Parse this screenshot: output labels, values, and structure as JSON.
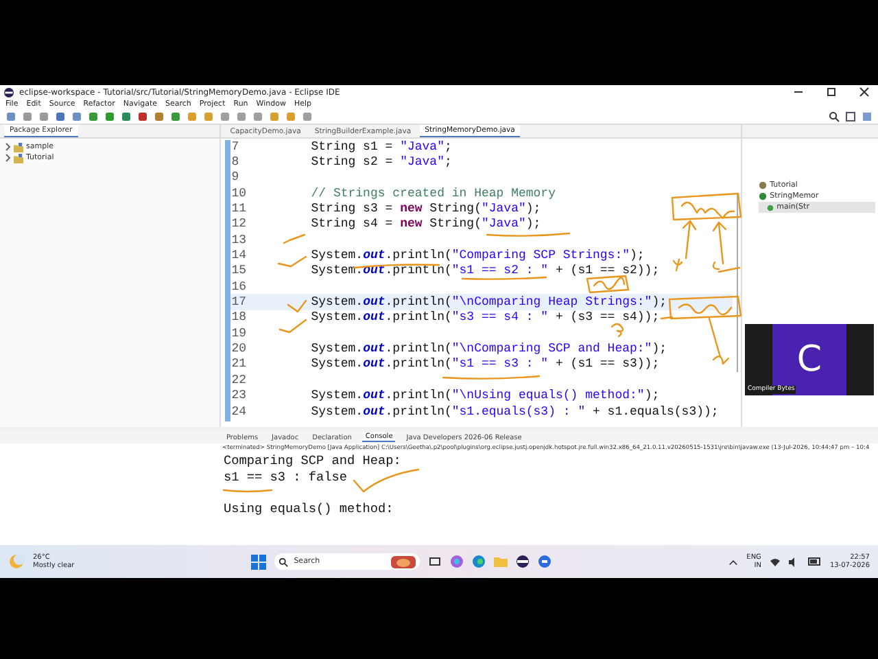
{
  "window": {
    "title": "eclipse-workspace - Tutorial/src/Tutorial/StringMemoryDemo.java - Eclipse IDE"
  },
  "menu": [
    "File",
    "Edit",
    "Source",
    "Refactor",
    "Navigate",
    "Search",
    "Project",
    "Run",
    "Window",
    "Help"
  ],
  "package_explorer": {
    "title": "Package Explorer",
    "items": [
      {
        "label": "sample",
        "expanded": false
      },
      {
        "label": "Tutorial",
        "expanded": false
      }
    ]
  },
  "editor": {
    "tabs": [
      {
        "label": "CapacityDemo.java",
        "selected": false
      },
      {
        "label": "StringBuilderExample.java",
        "selected": false
      },
      {
        "label": "StringMemoryDemo.java",
        "selected": true
      }
    ],
    "lines": [
      {
        "number": "7",
        "current": false,
        "tokens": [
          {
            "kind": "plain",
            "text": "String s1 = "
          },
          {
            "kind": "string",
            "text": "\"Java\""
          },
          {
            "kind": "plain",
            "text": ";"
          }
        ]
      },
      {
        "number": "8",
        "current": false,
        "tokens": [
          {
            "kind": "plain",
            "text": "String s2 = "
          },
          {
            "kind": "string",
            "text": "\"Java\""
          },
          {
            "kind": "plain",
            "text": ";"
          }
        ]
      },
      {
        "number": "9",
        "current": false
      },
      {
        "number": "10",
        "current": false,
        "tokens": [
          {
            "kind": "comment",
            "text": "// Strings created in Heap Memory"
          }
        ]
      },
      {
        "number": "11",
        "current": false,
        "tokens": [
          {
            "kind": "plain",
            "text": "String s3 = "
          },
          {
            "kind": "keyword",
            "text": "new"
          },
          {
            "kind": "plain",
            "text": " String("
          },
          {
            "kind": "string",
            "text": "\"Java\""
          },
          {
            "kind": "plain",
            "text": ");"
          }
        ]
      },
      {
        "number": "12",
        "current": false,
        "tokens": [
          {
            "kind": "plain",
            "text": "String s4 = "
          },
          {
            "kind": "keyword",
            "text": "new"
          },
          {
            "kind": "plain",
            "text": " String("
          },
          {
            "kind": "string",
            "text": "\"Java\""
          },
          {
            "kind": "plain",
            "text": ");"
          }
        ]
      },
      {
        "number": "13",
        "current": false
      },
      {
        "number": "14",
        "current": false,
        "tokens": [
          {
            "kind": "plain",
            "text": "System."
          },
          {
            "kind": "field",
            "text": "out"
          },
          {
            "kind": "plain",
            "text": ".println("
          },
          {
            "kind": "string",
            "text": "\"Comparing SCP Strings:\""
          },
          {
            "kind": "plain",
            "text": ");"
          }
        ]
      },
      {
        "number": "15",
        "current": false,
        "tokens": [
          {
            "kind": "plain",
            "text": "System."
          },
          {
            "kind": "field",
            "text": "out"
          },
          {
            "kind": "plain",
            "text": ".println("
          },
          {
            "kind": "string",
            "text": "\"s1 == s2 : \""
          },
          {
            "kind": "plain",
            "text": " + (s1 == s2));"
          }
        ]
      },
      {
        "number": "16",
        "current": false
      },
      {
        "number": "17",
        "current": true,
        "tokens": [
          {
            "kind": "plain",
            "text": "System."
          },
          {
            "kind": "field",
            "text": "out"
          },
          {
            "kind": "plain",
            "text": ".println("
          },
          {
            "kind": "string",
            "text": "\"\\nComparing Heap Strings:\""
          },
          {
            "kind": "plain",
            "text": ");"
          }
        ]
      },
      {
        "number": "18",
        "current": false,
        "tokens": [
          {
            "kind": "plain",
            "text": "System."
          },
          {
            "kind": "field",
            "text": "out"
          },
          {
            "kind": "plain",
            "text": ".println("
          },
          {
            "kind": "string",
            "text": "\"s3 == s4 : \""
          },
          {
            "kind": "plain",
            "text": " + (s3 == s4));"
          }
        ]
      },
      {
        "number": "19",
        "current": false
      },
      {
        "number": "20",
        "current": false,
        "tokens": [
          {
            "kind": "plain",
            "text": "System."
          },
          {
            "kind": "field",
            "text": "out"
          },
          {
            "kind": "plain",
            "text": ".println("
          },
          {
            "kind": "string",
            "text": "\"\\nComparing SCP and Heap:\""
          },
          {
            "kind": "plain",
            "text": ");"
          }
        ]
      },
      {
        "number": "21",
        "current": false,
        "tokens": [
          {
            "kind": "plain",
            "text": "System."
          },
          {
            "kind": "field",
            "text": "out"
          },
          {
            "kind": "plain",
            "text": ".println("
          },
          {
            "kind": "string",
            "text": "\"s1 == s3 : \""
          },
          {
            "kind": "plain",
            "text": " + (s1 == s3));"
          }
        ]
      },
      {
        "number": "22",
        "current": false
      },
      {
        "number": "23",
        "current": false,
        "tokens": [
          {
            "kind": "plain",
            "text": "System."
          },
          {
            "kind": "field",
            "text": "out"
          },
          {
            "kind": "plain",
            "text": ".println("
          },
          {
            "kind": "string",
            "text": "\"\\nUsing equals() method:\""
          },
          {
            "kind": "plain",
            "text": ");"
          }
        ]
      },
      {
        "number": "24",
        "current": false,
        "tokens": [
          {
            "kind": "plain",
            "text": "System."
          },
          {
            "kind": "field",
            "text": "out"
          },
          {
            "kind": "plain",
            "text": ".println("
          },
          {
            "kind": "string",
            "text": "\"s1.equals(s3) : \""
          },
          {
            "kind": "plain",
            "text": " + s1.equals(s3));"
          }
        ]
      }
    ]
  },
  "outline": {
    "items": [
      {
        "label": "Tutorial",
        "kind": "package"
      },
      {
        "label": "StringMemor",
        "kind": "class",
        "children": [
          {
            "label": "main(Str",
            "kind": "method",
            "selected": true
          }
        ]
      }
    ]
  },
  "console": {
    "tabs": [
      {
        "label": "Problems",
        "selected": false
      },
      {
        "label": "Javadoc",
        "selected": false
      },
      {
        "label": "Declaration",
        "selected": false
      },
      {
        "label": "Console",
        "selected": true
      },
      {
        "label": "Java Developers 2026-06 Release",
        "selected": false
      }
    ],
    "process": "<terminated> StringMemoryDemo [Java Application] C:\\Users\\Geetha\\.p2\\pool\\plugins\\org.eclipse.justj.openjdk.hotspot.jre.full.win32.x86_64_21.0.11.v20260515-1531\\jre\\bin\\javaw.exe  (13-Jul-2026, 10:44:47 pm – 10:4",
    "paragraphs": [
      {
        "lines": [
          "Comparing SCP and Heap:",
          "s1 == s3 : false"
        ]
      },
      {
        "lines": [
          "Using equals() method:"
        ]
      }
    ]
  },
  "video_overlay": {
    "initial": "C",
    "caption": "Compiler Bytes"
  },
  "taskbar": {
    "weather": {
      "temperature": "26°C",
      "condition": "Mostly clear"
    },
    "search": {
      "placeholder": "Search"
    },
    "language": {
      "code": "ENG",
      "region": "IN"
    },
    "clock": {
      "time": "22:57",
      "date": "13-07-2026"
    }
  }
}
